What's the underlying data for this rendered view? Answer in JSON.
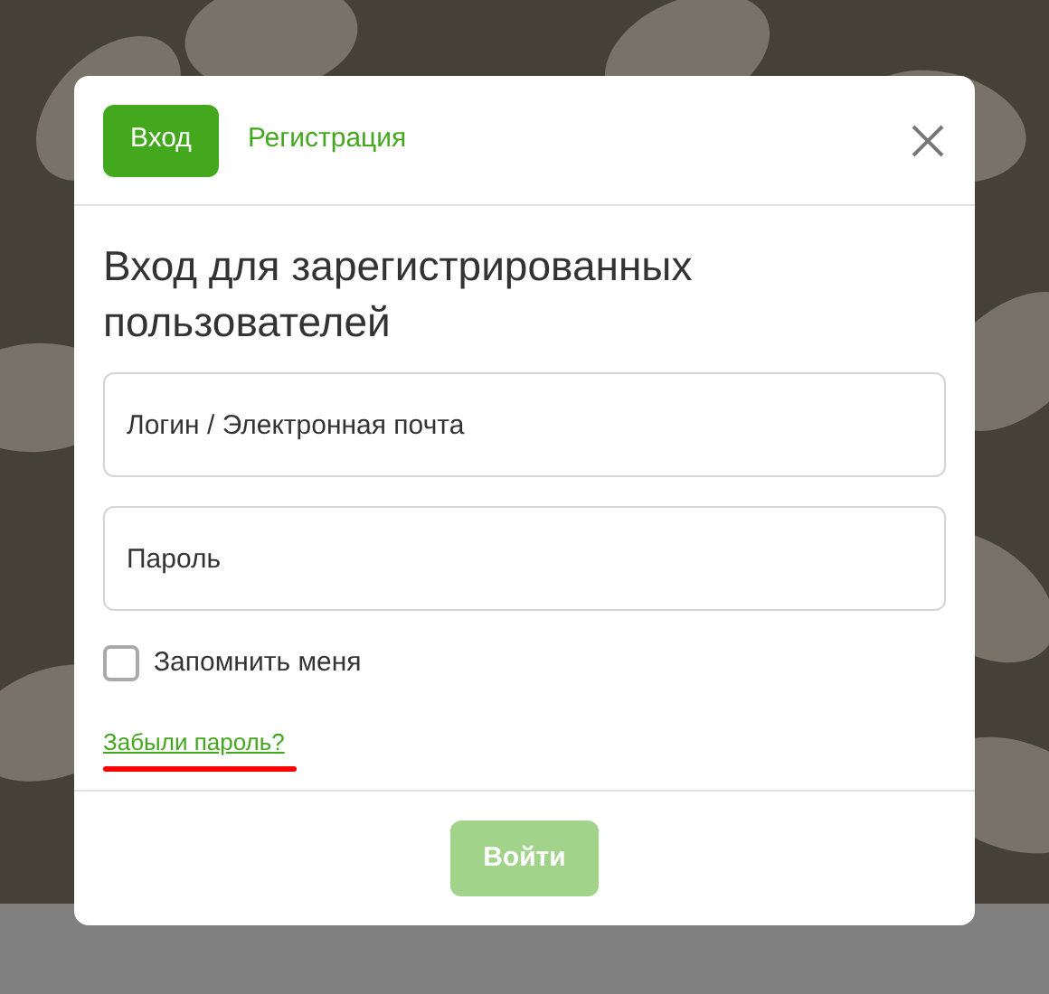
{
  "tabs": [
    {
      "label": "Вход",
      "selected": true
    },
    {
      "label": "Регистрация",
      "selected": false
    }
  ],
  "heading": "Вход для зарегистрированных пользователей",
  "fields": [
    {
      "placeholder": "Логин / Электронная почта"
    },
    {
      "placeholder": "Пароль"
    }
  ],
  "remember": {
    "label": "Запомнить меня",
    "checked": false
  },
  "forgot_link": {
    "label": "Забыли пароль?",
    "marked": true
  },
  "submit": {
    "label": "Войти",
    "disabled": true
  }
}
